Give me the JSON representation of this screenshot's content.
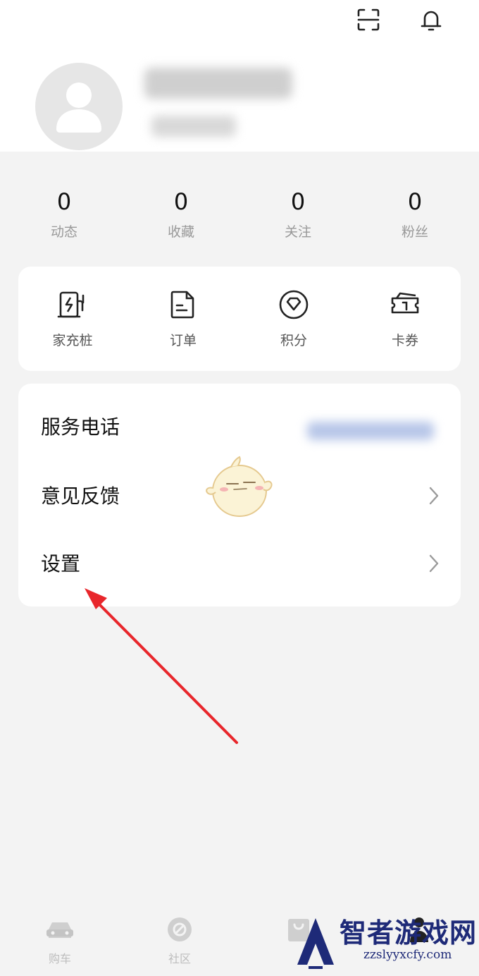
{
  "header": {
    "scan_icon": "scan-icon",
    "bell_icon": "bell-icon"
  },
  "profile": {
    "avatar_icon": "user-icon",
    "username_blurred": "",
    "subtitle_blurred": ""
  },
  "stats": [
    {
      "value": "0",
      "label": "动态"
    },
    {
      "value": "0",
      "label": "收藏"
    },
    {
      "value": "0",
      "label": "关注"
    },
    {
      "value": "0",
      "label": "粉丝"
    }
  ],
  "quick_actions": [
    {
      "label": "家充桩",
      "icon": "charger-icon"
    },
    {
      "label": "订单",
      "icon": "order-icon"
    },
    {
      "label": "积分",
      "icon": "points-icon"
    },
    {
      "label": "卡券",
      "icon": "coupon-icon"
    }
  ],
  "menu": {
    "service_phone": {
      "label": "服务电话",
      "value_blurred": ""
    },
    "feedback": {
      "label": "意见反馈"
    },
    "settings": {
      "label": "设置"
    }
  },
  "tabbar": [
    {
      "label": "购车",
      "icon": "car-icon"
    },
    {
      "label": "社区",
      "icon": "community-icon"
    },
    {
      "label": "",
      "icon": "shop-icon"
    },
    {
      "label": "",
      "icon": "profile-icon"
    }
  ],
  "watermark": {
    "brand": "智者游戏网",
    "url": "zzslyyxcfy.com"
  },
  "colors": {
    "accent_arrow": "#e8262b",
    "background": "#f3f3f3",
    "card": "#ffffff",
    "muted_text": "#999999"
  }
}
